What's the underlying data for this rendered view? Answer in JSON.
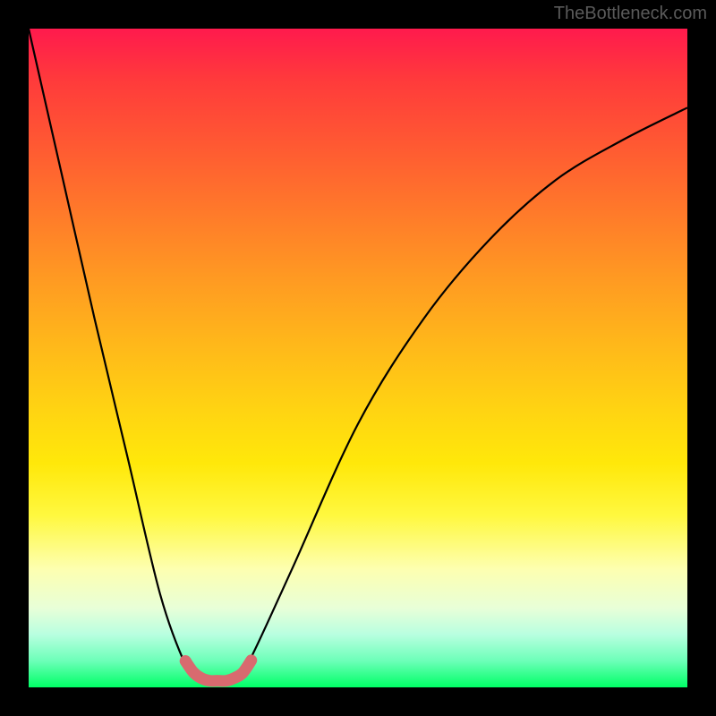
{
  "watermark": "TheBottleneck.com",
  "chart_data": {
    "type": "line",
    "title": "",
    "xlabel": "",
    "ylabel": "",
    "xlim": [
      0,
      1
    ],
    "ylim": [
      0,
      1
    ],
    "series": [
      {
        "name": "bottleneck-curve",
        "x": [
          0.0,
          0.05,
          0.1,
          0.15,
          0.2,
          0.24,
          0.26,
          0.28,
          0.3,
          0.32,
          0.34,
          0.4,
          0.5,
          0.6,
          0.7,
          0.8,
          0.9,
          1.0
        ],
        "y": [
          1.0,
          0.78,
          0.56,
          0.35,
          0.14,
          0.03,
          0.01,
          0.01,
          0.01,
          0.02,
          0.05,
          0.18,
          0.4,
          0.56,
          0.68,
          0.77,
          0.83,
          0.88
        ]
      },
      {
        "name": "optimal-band",
        "x": [
          0.238,
          0.25,
          0.262,
          0.275,
          0.287,
          0.3,
          0.312,
          0.325,
          0.338
        ],
        "y": [
          0.04,
          0.023,
          0.014,
          0.01,
          0.01,
          0.01,
          0.014,
          0.022,
          0.041
        ]
      }
    ],
    "annotations": [],
    "colors": {
      "curve": "#000000",
      "optimal_band": "#d86a6f",
      "gradient_top": "#ff1a4d",
      "gradient_bottom": "#00ff66"
    }
  }
}
